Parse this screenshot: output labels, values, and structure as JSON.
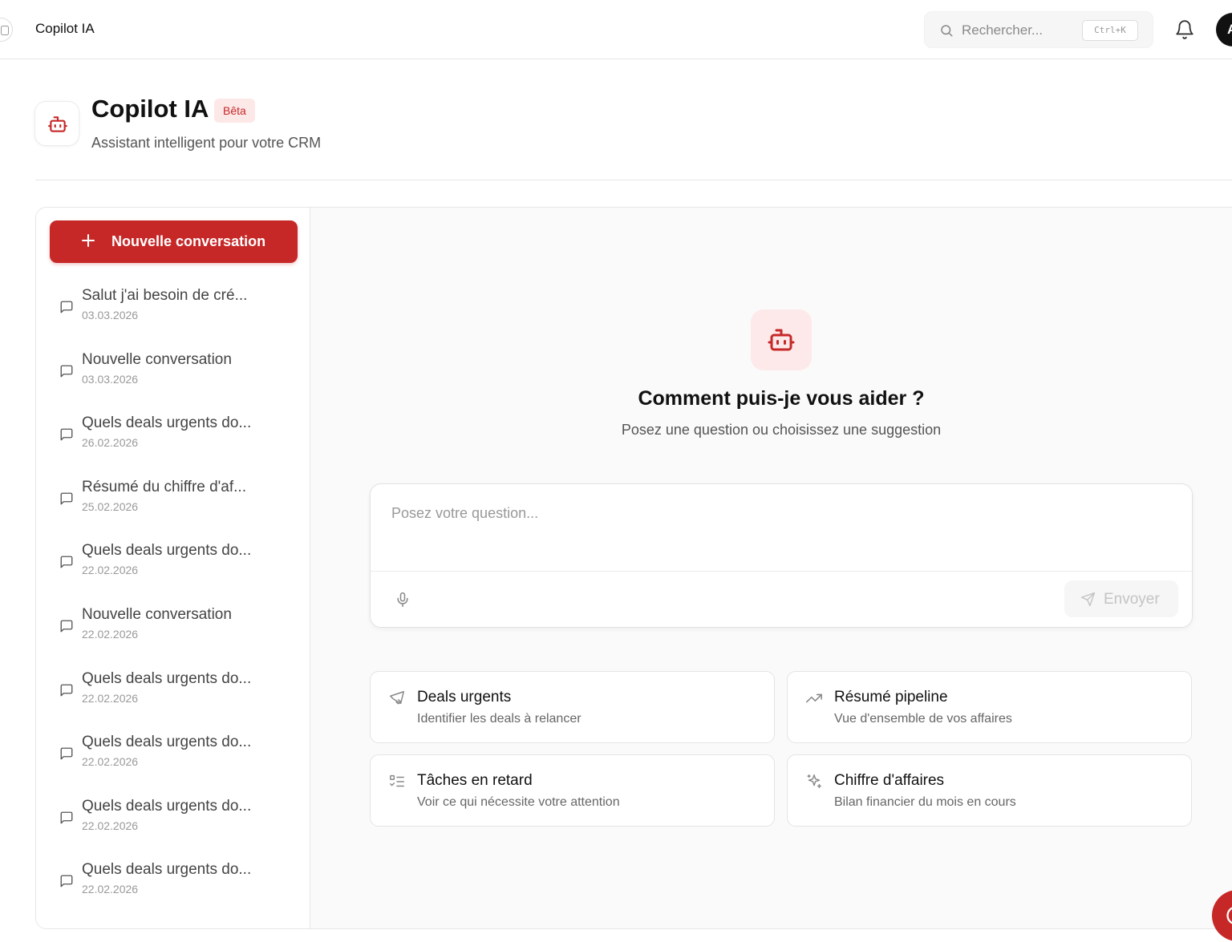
{
  "topbar": {
    "title": "Copilot IA",
    "search_placeholder": "Rechercher...",
    "shortcut": "Ctrl+K",
    "avatar_initial": "A"
  },
  "header": {
    "title": "Copilot IA",
    "badge": "Bêta",
    "subtitle": "Assistant intelligent pour votre CRM"
  },
  "sidebar": {
    "new_button": "Nouvelle conversation",
    "conversations": [
      {
        "title": "Salut j'ai besoin de cré...",
        "date": "03.03.2026"
      },
      {
        "title": "Nouvelle conversation",
        "date": "03.03.2026"
      },
      {
        "title": "Quels deals urgents do...",
        "date": "26.02.2026"
      },
      {
        "title": "Résumé du chiffre d'af...",
        "date": "25.02.2026"
      },
      {
        "title": "Quels deals urgents do...",
        "date": "22.02.2026"
      },
      {
        "title": "Nouvelle conversation",
        "date": "22.02.2026"
      },
      {
        "title": "Quels deals urgents do...",
        "date": "22.02.2026"
      },
      {
        "title": "Quels deals urgents do...",
        "date": "22.02.2026"
      },
      {
        "title": "Quels deals urgents do...",
        "date": "22.02.2026"
      },
      {
        "title": "Quels deals urgents do...",
        "date": "22.02.2026"
      }
    ]
  },
  "chat": {
    "welcome_title": "Comment puis-je vous aider ?",
    "welcome_subtitle": "Posez une question ou choisissez une suggestion",
    "input_placeholder": "Posez votre question...",
    "send_label": "Envoyer"
  },
  "suggestions": [
    {
      "title": "Deals urgents",
      "desc": "Identifier les deals à relancer",
      "icon": "handshake-icon"
    },
    {
      "title": "Résumé pipeline",
      "desc": "Vue d'ensemble de vos affaires",
      "icon": "trending-up-icon"
    },
    {
      "title": "Tâches en retard",
      "desc": "Voir ce qui nécessite votre attention",
      "icon": "task-list-icon"
    },
    {
      "title": "Chiffre d'affaires",
      "desc": "Bilan financier du mois en cours",
      "icon": "sparkles-icon"
    }
  ],
  "colors": {
    "accent": "#c62828",
    "accent_light": "#fde9e9",
    "border": "#e6e6e6",
    "chat_bg": "#fafafa"
  }
}
